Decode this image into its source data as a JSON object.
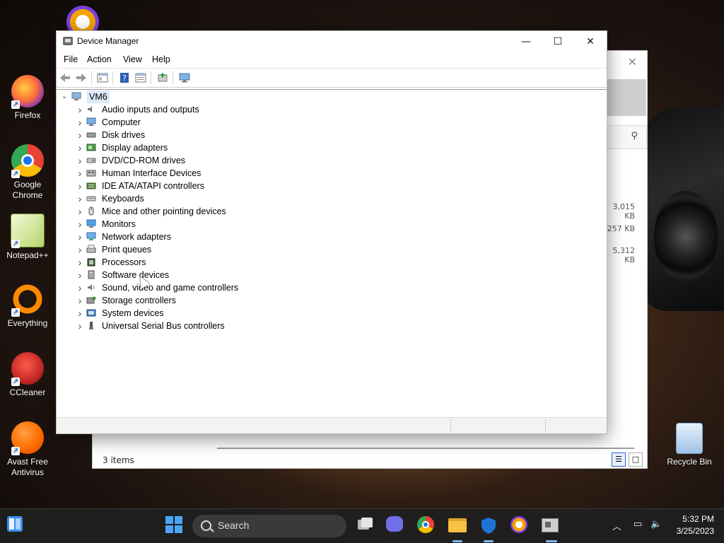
{
  "desktop": {
    "icons": [
      {
        "label": "Firefox",
        "icon": "firefox-icon",
        "color": "#ff7139"
      },
      {
        "label": "Google Chrome",
        "icon": "chrome-icon",
        "color": "#1a73e8"
      },
      {
        "label": "Notepad++",
        "icon": "notepadpp-icon",
        "color": "#8bc34a"
      },
      {
        "label": "Everything",
        "icon": "everything-icon",
        "color": "#ff8a00"
      },
      {
        "label": "CCleaner",
        "icon": "ccleaner-icon",
        "color": "#e53935"
      },
      {
        "label": "Avast Free Antivirus",
        "icon": "avast-icon",
        "color": "#ff6d00"
      }
    ],
    "recycle_bin": {
      "label": "Recycle Bin",
      "icon": "recycle-bin-icon"
    }
  },
  "background_window": {
    "status": "3 items",
    "sizes": [
      "3,015 KB",
      "257 KB",
      "5,312 KB"
    ]
  },
  "device_manager": {
    "title": "Device Manager",
    "menu": {
      "file": "File",
      "action": "Action",
      "view": "View",
      "help": "Help"
    },
    "toolbar_icons": [
      "back-icon",
      "forward-icon",
      "properties-icon",
      "help-icon",
      "details-icon",
      "update-driver-icon",
      "monitor-icon"
    ],
    "root": "VM6",
    "categories": [
      {
        "label": "Audio inputs and outputs",
        "icon": "speaker-icon"
      },
      {
        "label": "Computer",
        "icon": "computer-icon"
      },
      {
        "label": "Disk drives",
        "icon": "disk-icon"
      },
      {
        "label": "Display adapters",
        "icon": "display-adapter-icon"
      },
      {
        "label": "DVD/CD-ROM drives",
        "icon": "dvd-icon"
      },
      {
        "label": "Human Interface Devices",
        "icon": "hid-icon"
      },
      {
        "label": "IDE ATA/ATAPI controllers",
        "icon": "ide-icon"
      },
      {
        "label": "Keyboards",
        "icon": "keyboard-icon"
      },
      {
        "label": "Mice and other pointing devices",
        "icon": "mouse-icon"
      },
      {
        "label": "Monitors",
        "icon": "monitor-icon"
      },
      {
        "label": "Network adapters",
        "icon": "network-icon"
      },
      {
        "label": "Print queues",
        "icon": "printer-icon"
      },
      {
        "label": "Processors",
        "icon": "processor-icon"
      },
      {
        "label": "Software devices",
        "icon": "software-device-icon"
      },
      {
        "label": "Sound, video and game controllers",
        "icon": "sound-icon"
      },
      {
        "label": "Storage controllers",
        "icon": "storage-icon"
      },
      {
        "label": "System devices",
        "icon": "system-icon"
      },
      {
        "label": "Universal Serial Bus controllers",
        "icon": "usb-icon"
      }
    ]
  },
  "taskbar": {
    "search_label": "Search",
    "time": "5:32 PM",
    "date": "3/25/2023"
  }
}
